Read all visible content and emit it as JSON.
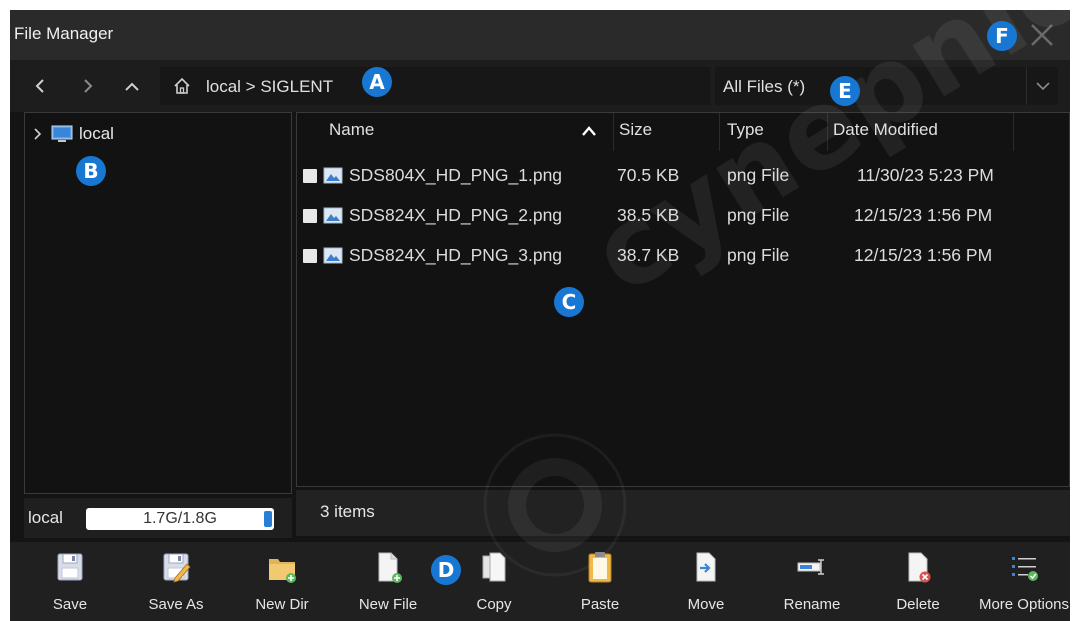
{
  "window": {
    "title": "File Manager"
  },
  "nav": {
    "path": "local > SIGLENT",
    "filter_value": "All Files (*)"
  },
  "tree": {
    "root_label": "local"
  },
  "storage": {
    "label": "local",
    "usage_text": "1.7G/1.8G",
    "used_fraction": 0.94
  },
  "table": {
    "columns": [
      "Name",
      "Size",
      "Type",
      "Date Modified"
    ],
    "sort_column": "Name",
    "sort_direction": "ascending",
    "rows": [
      {
        "name": "SDS804X_HD_PNG_1.png",
        "size": "70.5 KB",
        "type": "png File",
        "date": "11/30/23 5:23 PM"
      },
      {
        "name": "SDS824X_HD_PNG_2.png",
        "size": "38.5 KB",
        "type": "png File",
        "date": "12/15/23 1:56 PM"
      },
      {
        "name": "SDS824X_HD_PNG_3.png",
        "size": "38.7 KB",
        "type": "png File",
        "date": "12/15/23 1:56 PM"
      }
    ]
  },
  "status": {
    "items_text": "3 items"
  },
  "toolbar": {
    "save": "Save",
    "save_as": "Save As",
    "new_dir": "New Dir",
    "new_file": "New File",
    "copy": "Copy",
    "paste": "Paste",
    "move": "Move",
    "rename": "Rename",
    "delete": "Delete",
    "more_options": "More Options"
  },
  "callouts": {
    "a": "A",
    "b": "B",
    "c": "C",
    "d": "D",
    "e": "E",
    "f": "F"
  },
  "watermark": {
    "text": "cynepnic"
  },
  "colors": {
    "badge": "#1877d2",
    "background": "#141414",
    "accent": "#2a7fd4"
  }
}
